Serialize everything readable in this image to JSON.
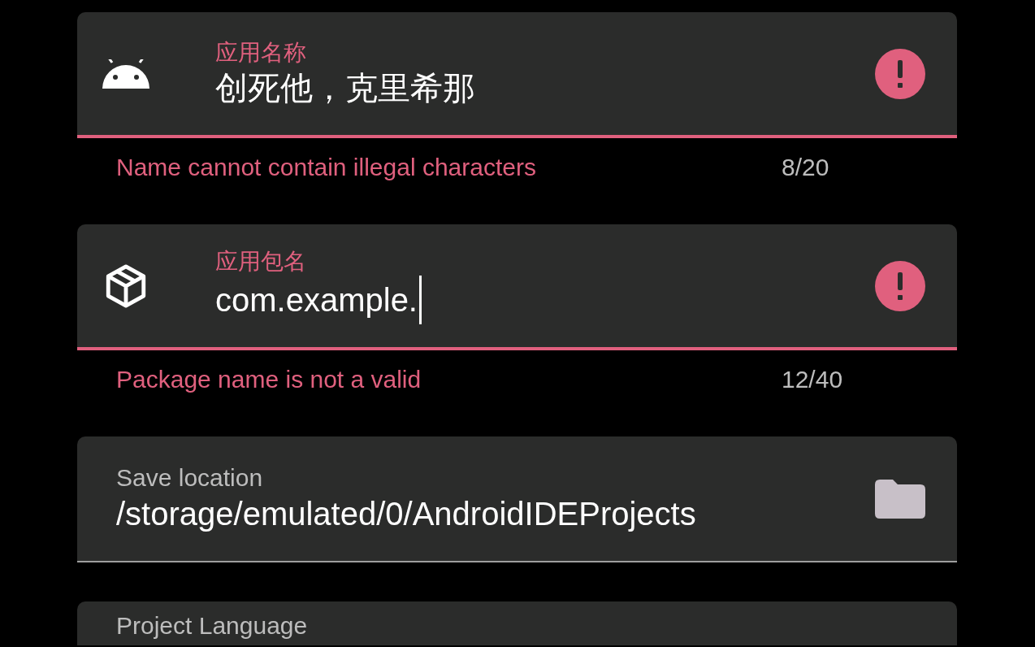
{
  "fields": [
    {
      "kind": "text",
      "label": "应用名称",
      "value": "创死他，克里希那",
      "error": true,
      "focused": false,
      "helper": "Name cannot contain illegal characters",
      "counter": "8/20"
    },
    {
      "kind": "text",
      "label": "应用包名",
      "value": "com.example.",
      "error": true,
      "focused": true,
      "helper": "Package name is not a valid",
      "counter": "12/40"
    },
    {
      "kind": "path",
      "label": "Save location",
      "value": "/storage/emulated/0/AndroidIDEProjects",
      "error": false,
      "focused": false
    },
    {
      "kind": "select",
      "label": "Project Language"
    }
  ]
}
